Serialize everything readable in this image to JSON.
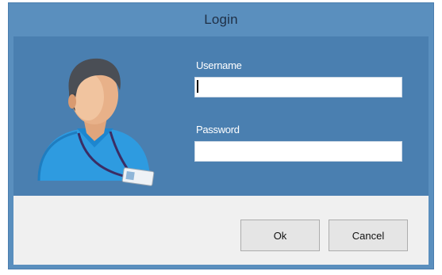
{
  "window": {
    "title": "Login"
  },
  "form": {
    "username_label": "Username",
    "username_value": "",
    "password_label": "Password",
    "password_value": ""
  },
  "buttons": {
    "ok_label": "Ok",
    "cancel_label": "Cancel"
  },
  "icons": {
    "avatar": "user-with-badge-icon"
  },
  "colors": {
    "frame": "#5a8fbe",
    "panel": "#4a7fb0",
    "footer": "#f0f0f0"
  }
}
